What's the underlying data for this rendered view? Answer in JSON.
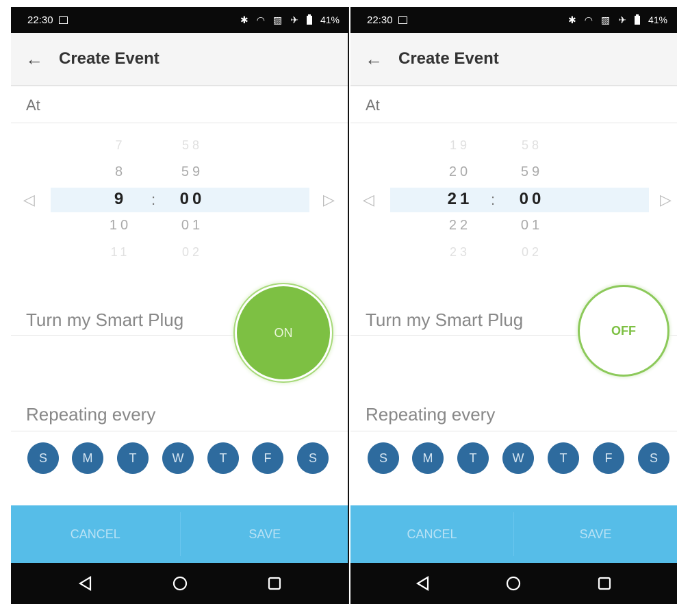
{
  "screens": [
    {
      "status": {
        "time": "22:30",
        "battery": "41%"
      },
      "header": {
        "back_icon": "arrow-left-icon",
        "title": "Create Event"
      },
      "at_label": "At",
      "picker": {
        "hours": [
          "7",
          "8",
          "9",
          "10",
          "11"
        ],
        "minutes": [
          "58",
          "59",
          "00",
          "01",
          "02"
        ],
        "separator": ":"
      },
      "plug": {
        "label": "Turn my Smart Plug",
        "state": "ON"
      },
      "repeat": {
        "label": "Repeating every",
        "days": [
          "S",
          "M",
          "T",
          "W",
          "T",
          "F",
          "S"
        ]
      },
      "actions": {
        "cancel": "CANCEL",
        "save": "SAVE"
      }
    },
    {
      "status": {
        "time": "22:30",
        "battery": "41%"
      },
      "header": {
        "back_icon": "arrow-left-icon",
        "title": "Create Event"
      },
      "at_label": "At",
      "picker": {
        "hours": [
          "19",
          "20",
          "21",
          "22",
          "23"
        ],
        "minutes": [
          "58",
          "59",
          "00",
          "01",
          "02"
        ],
        "separator": ":"
      },
      "plug": {
        "label": "Turn my Smart Plug",
        "state": "OFF"
      },
      "repeat": {
        "label": "Repeating every",
        "days": [
          "S",
          "M",
          "T",
          "W",
          "T",
          "F",
          "S"
        ]
      },
      "actions": {
        "cancel": "CANCEL",
        "save": "SAVE"
      }
    }
  ],
  "colors": {
    "accent_blue": "#56bde8",
    "day_circle": "#2e6b9e",
    "plug_green": "#7dc043",
    "picker_highlight": "#eaf4fb"
  }
}
